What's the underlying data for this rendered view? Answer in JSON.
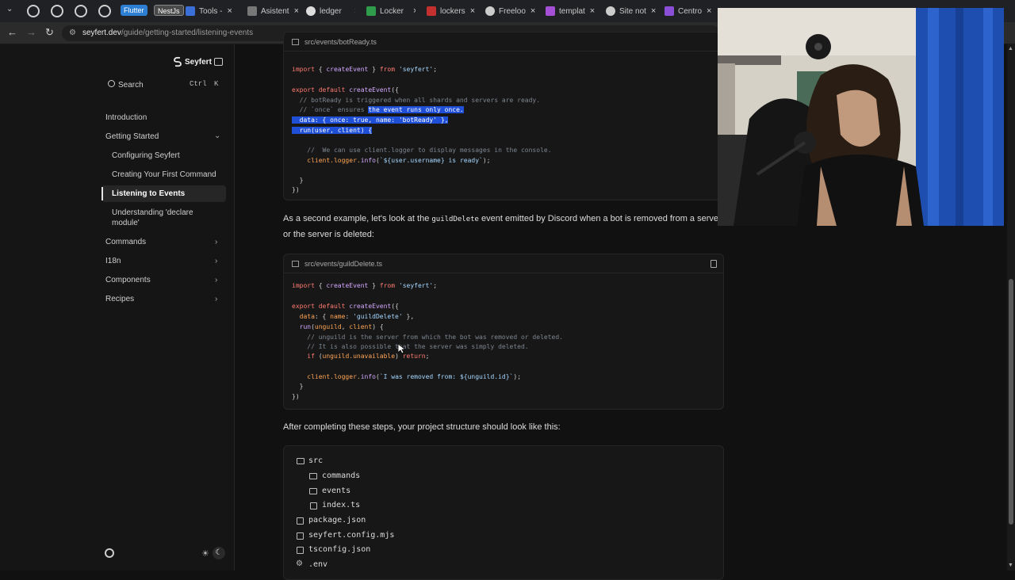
{
  "browser": {
    "tabs": [
      {
        "label": "Flutter",
        "kind": "pill",
        "color": "#2d7fd3"
      },
      {
        "label": "NestJs",
        "kind": "pill",
        "color": "#4a4a4a"
      },
      {
        "label": "Tools -",
        "color": "#3b6fd8"
      },
      {
        "label": "Asistent",
        "color": "#777777"
      },
      {
        "label": "ledger",
        "color": "#dddddd"
      },
      {
        "label": "Locker",
        "color": "#2e9c4a"
      },
      {
        "label": "lockers",
        "color": "#c43030"
      },
      {
        "label": "Freeloo",
        "color": "#cccccc"
      },
      {
        "label": "templat",
        "color": "#a44fd6"
      },
      {
        "label": "Site not",
        "color": "#cccccc"
      },
      {
        "label": "Centro",
        "color": "#8a4fd6"
      }
    ],
    "url_host": "seyfert.dev",
    "url_path": "/guide/getting-started/listening-events"
  },
  "sidebar": {
    "brand": "Seyfert",
    "search_label": "Search",
    "search_kbd_1": "Ctrl",
    "search_kbd_2": "K",
    "items": [
      {
        "label": "Introduction"
      },
      {
        "label": "Getting Started"
      },
      {
        "label": "Configuring Seyfert"
      },
      {
        "label": "Creating Your First Command"
      },
      {
        "label": "Listening to Events"
      },
      {
        "label": "Understanding 'declare"
      },
      {
        "label": "module'"
      },
      {
        "label": "Commands"
      },
      {
        "label": "I18n"
      },
      {
        "label": "Components"
      },
      {
        "label": "Recipes"
      }
    ]
  },
  "content": {
    "code1_file": "src/events/botReady.ts",
    "code1_lines": {
      "l1": "import { createEvent } from 'seyfert';",
      "l2": "export default createEvent({",
      "l3": "  // botReady is triggered when all shards and servers are ready.",
      "l4a": "  // `once` ensures ",
      "l4b": "the event runs only once.",
      "l5": "  data: { once: true, name: 'botReady' },",
      "l6": "  run(user, client) {",
      "l7": "    //  We can use client.logger to display messages in the console.",
      "l8": "    client.logger.info(`${user.username} is ready`);",
      "l9": "  }",
      "l10": "})"
    },
    "para1_a": "As a second example, let's look at the ",
    "para1_code": "guildDelete",
    "para1_b": " event emitted by Discord when a bot is removed from a serve",
    "para1_c": "or the server is deleted:",
    "code2_file": "src/events/guildDelete.ts",
    "code2_lines": {
      "l1": "import { createEvent } from 'seyfert';",
      "l2": "export default createEvent({",
      "l3": "  data: { name: 'guildDelete' },",
      "l4": "  run(unguild, client) {",
      "l5": "    // unguild is the server from which the bot was removed or deleted.",
      "l6": "    // It is also possible that the server was simply deleted.",
      "l7": "    if (unguild.unavailable) return;",
      "l8": "    client.logger.info(`I was removed from: ${unguild.id}`);",
      "l9": "  }",
      "l10": "})"
    },
    "para2": "After completing these steps, your project structure should look like this:",
    "tree": [
      {
        "name": "src"
      },
      {
        "name": "commands"
      },
      {
        "name": "events"
      },
      {
        "name": "index.ts"
      },
      {
        "name": "package.json"
      },
      {
        "name": "seyfert.config.mjs"
      },
      {
        "name": "tsconfig.json"
      },
      {
        "name": ".env"
      }
    ]
  }
}
